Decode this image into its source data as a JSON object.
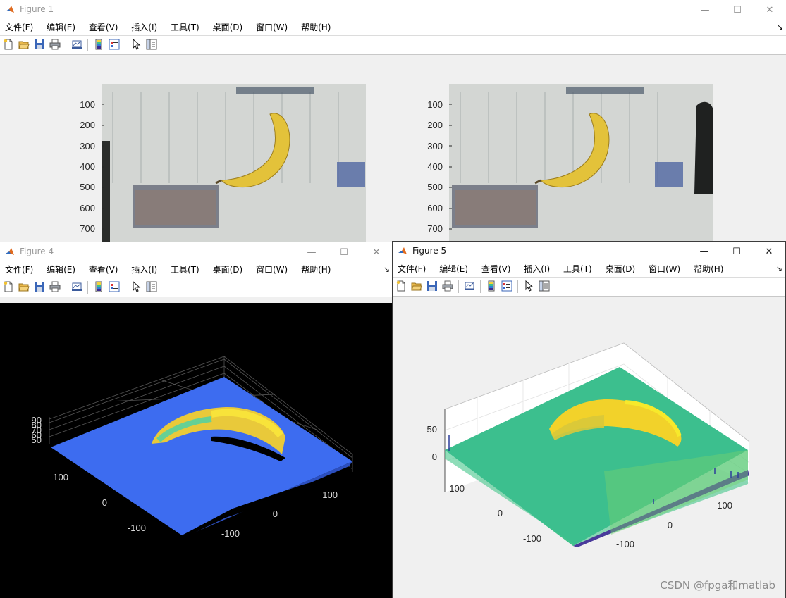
{
  "menus": [
    "文件(F)",
    "编辑(E)",
    "查看(V)",
    "插入(I)",
    "工具(T)",
    "桌面(D)",
    "窗口(W)",
    "帮助(H)"
  ],
  "menu_overflow": "↘",
  "window_controls": {
    "minimize": "—",
    "maximize": "☐",
    "close": "✕"
  },
  "toolbar_icons": [
    "new-figure-icon",
    "open-file-icon",
    "save-icon",
    "print-icon",
    "link-plot-icon",
    "colorbar-icon",
    "legend-icon",
    "pointer-icon",
    "property-inspector-icon"
  ],
  "figure1": {
    "title": "Figure 1",
    "left_yticks": [
      "100",
      "200",
      "300",
      "400",
      "500",
      "600",
      "700"
    ],
    "right_yticks": [
      "100",
      "200",
      "300",
      "400",
      "500",
      "600",
      "700"
    ]
  },
  "figure4": {
    "title": "Figure 4",
    "zticks": [
      "90",
      "80",
      "70",
      "60",
      "50"
    ],
    "yticks": [
      "100",
      "0",
      "-100"
    ],
    "xticks": [
      "100",
      "0",
      "-100"
    ]
  },
  "figure5": {
    "title": "Figure 5",
    "zticks": [
      "50",
      "0"
    ],
    "yticks": [
      "100",
      "0",
      "-100"
    ],
    "xticks": [
      "100",
      "0",
      "-100"
    ]
  },
  "watermark": "CSDN @fpga和matlab",
  "colors": {
    "fig4_background": "#000000",
    "fig4_plane": "#3d6cf0",
    "fig4_banana": "#f5d12a",
    "fig5_plane": "#35bf8f",
    "fig5_banana": "#f7dc2a"
  }
}
